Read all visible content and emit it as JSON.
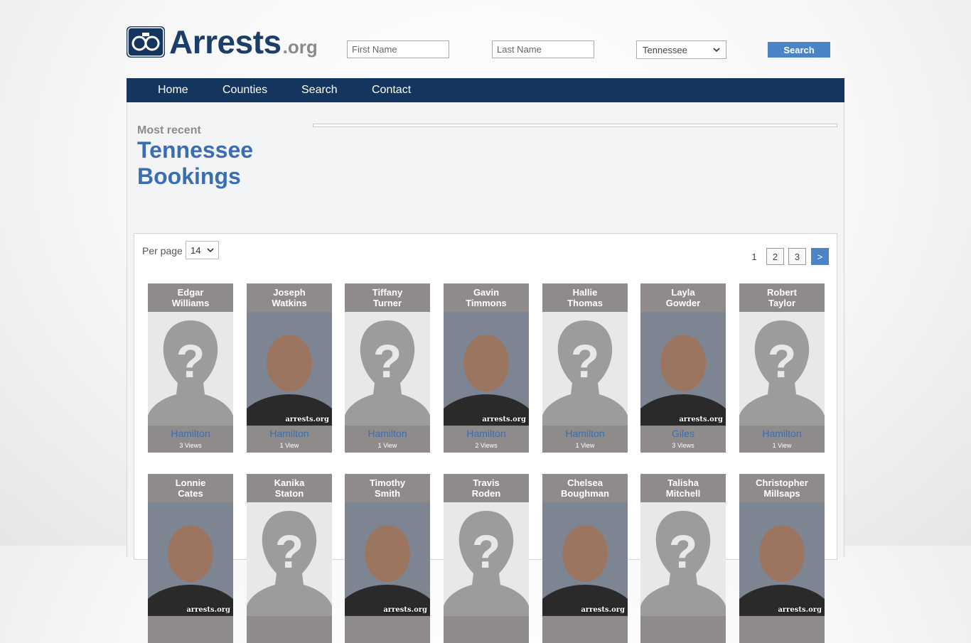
{
  "header": {
    "logo_text": "Arrests",
    "logo_suffix": ".org",
    "first_name_placeholder": "First Name",
    "last_name_placeholder": "Last Name",
    "state_value": "Tennessee",
    "search_label": "Search"
  },
  "nav": {
    "items": [
      "Home",
      "Counties",
      "Search",
      "Contact"
    ]
  },
  "main": {
    "kicker": "Most recent",
    "title_line1": "Tennessee",
    "title_line2": "Bookings"
  },
  "listing": {
    "per_page_label": "Per page",
    "per_page_value": "14",
    "pages": [
      "1",
      "2",
      "3"
    ],
    "next_label": ">"
  },
  "watermark": "arrests.org",
  "bookings": [
    {
      "first": "Edgar",
      "last": "Williams",
      "county": "Hamilton",
      "views": "3 Views",
      "photo": "placeholder-icon"
    },
    {
      "first": "Joseph",
      "last": "Watkins",
      "county": "Hamilton",
      "views": "1 View",
      "photo": "mugshot"
    },
    {
      "first": "Tiffany",
      "last": "Turner",
      "county": "Hamilton",
      "views": "1 View",
      "photo": "placeholder-icon"
    },
    {
      "first": "Gavin",
      "last": "Timmons",
      "county": "Hamilton",
      "views": "2 Views",
      "photo": "mugshot"
    },
    {
      "first": "Hallie",
      "last": "Thomas",
      "county": "Hamilton",
      "views": "1 View",
      "photo": "placeholder-icon"
    },
    {
      "first": "Layla",
      "last": "Gowder",
      "county": "Giles",
      "views": "3 Views",
      "photo": "mugshot"
    },
    {
      "first": "Robert",
      "last": "Taylor",
      "county": "Hamilton",
      "views": "1 View",
      "photo": "placeholder-icon"
    },
    {
      "first": "Lonnie",
      "last": "Cates",
      "photo": "mugshot"
    },
    {
      "first": "Kanika",
      "last": "Staton",
      "photo": "placeholder-icon"
    },
    {
      "first": "Timothy",
      "last": "Smith",
      "photo": "mugshot"
    },
    {
      "first": "Travis",
      "last": "Roden",
      "photo": "placeholder-icon"
    },
    {
      "first": "Chelsea",
      "last": "Boughman",
      "photo": "mugshot"
    },
    {
      "first": "Talisha",
      "last": "Mitchell",
      "photo": "placeholder-icon"
    },
    {
      "first": "Christopher",
      "last": "Millsaps",
      "photo": "mugshot"
    }
  ],
  "colors": {
    "brand_navy": "#14355e",
    "accent_blue": "#4a84c7",
    "link_blue": "#3a6eb3",
    "card_gray": "#8f8b8b"
  }
}
